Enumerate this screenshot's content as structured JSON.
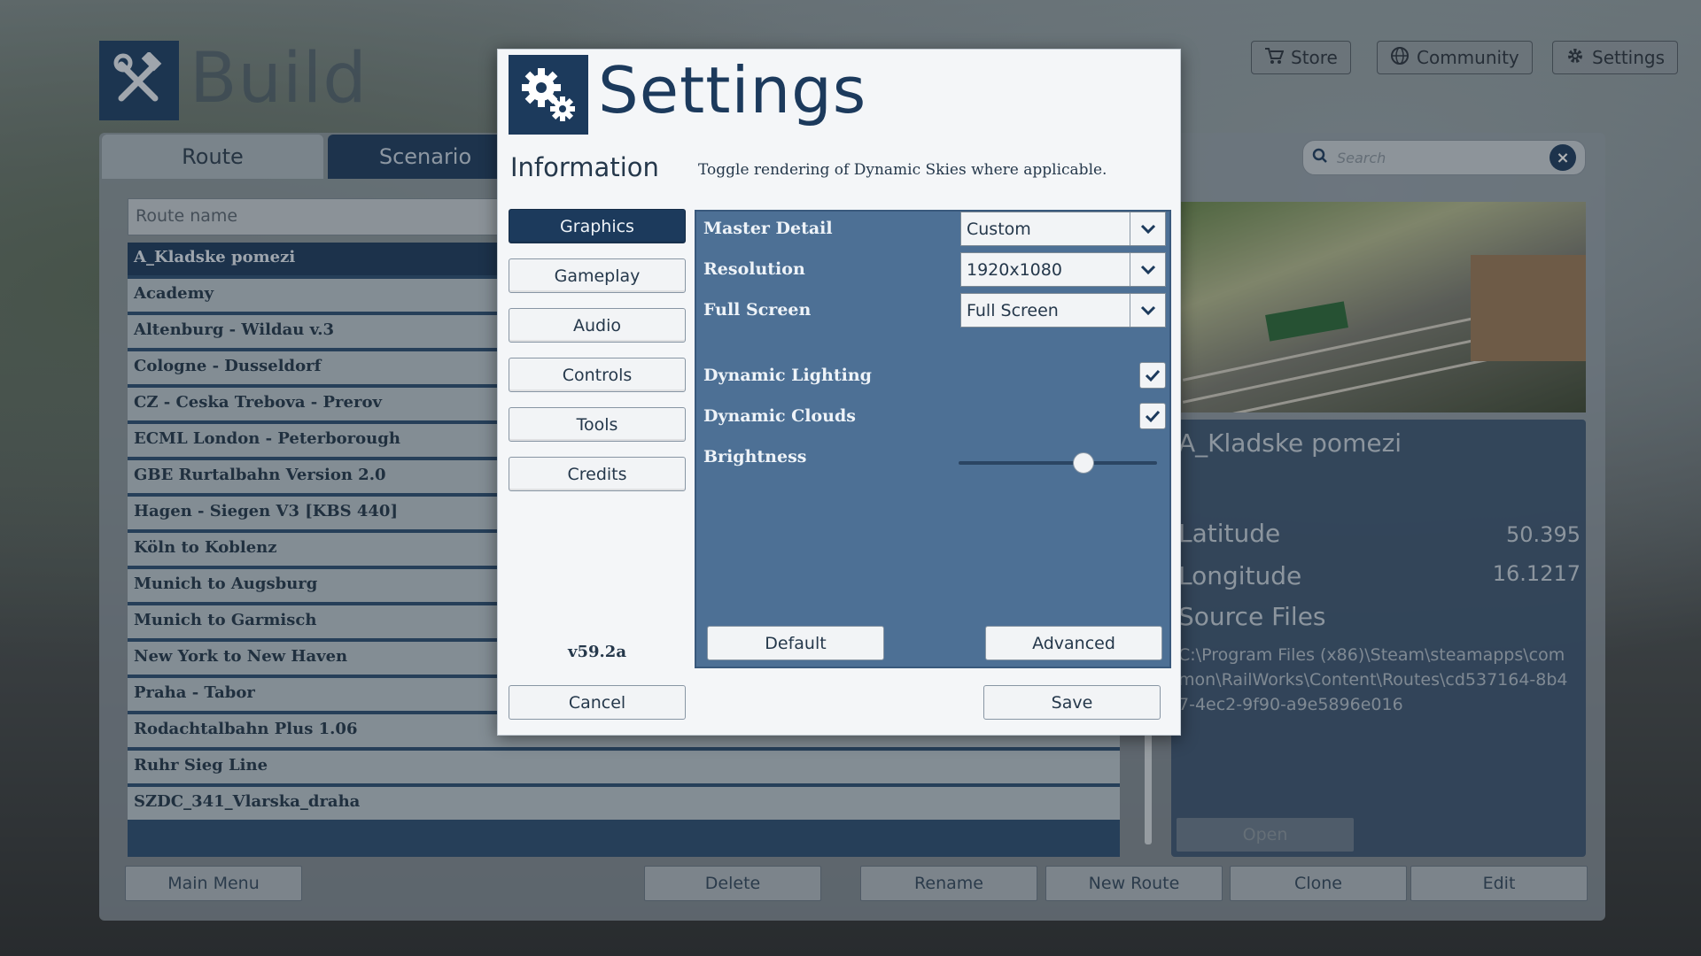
{
  "app": {
    "title": "Build",
    "top_buttons": [
      {
        "label": "Store",
        "icon": "cart-icon"
      },
      {
        "label": "Community",
        "icon": "globe-icon"
      },
      {
        "label": "Settings",
        "icon": "gear-icon"
      }
    ],
    "tabs": [
      {
        "label": "Route",
        "active": true
      },
      {
        "label": "Scenario",
        "active": false
      }
    ],
    "route_name_placeholder": "Route name",
    "search_placeholder": "Search",
    "routes": [
      "A_Kladske pomezi",
      "Academy",
      "Altenburg - Wildau v.3",
      "Cologne - Dusseldorf",
      "CZ - Ceska Trebova - Prerov",
      "ECML London - Peterborough",
      "GBE Rurtalbahn Version 2.0",
      "Hagen - Siegen V3 [KBS 440]",
      "Köln to Koblenz",
      "Munich to Augsburg",
      "Munich to Garmisch",
      "New York to New Haven",
      "Praha - Tabor",
      "Rodachtalbahn Plus 1.06",
      "Ruhr Sieg Line",
      "SZDC_341_Vlarska_draha"
    ],
    "selected_route_index": 0,
    "details": {
      "title": "A_Kladske pomezi",
      "latitude_label": "Latitude",
      "latitude": "50.395",
      "longitude_label": "Longitude",
      "longitude": "16.1217",
      "source_label": "Source Files",
      "source_path": "C:\\Program Files (x86)\\Steam\\steamapps\\common\\RailWorks\\Content\\Routes\\cd537164-8b47-4ec2-9f90-a9e5896e016",
      "open_label": "Open"
    },
    "bottom_buttons": [
      "Main Menu",
      "Delete",
      "Rename",
      "New Route",
      "Clone",
      "Edit"
    ]
  },
  "settings": {
    "title": "Settings",
    "section": "Information",
    "info_text": "Toggle rendering of Dynamic Skies where applicable.",
    "nav": [
      {
        "label": "Graphics",
        "active": true
      },
      {
        "label": "Gameplay",
        "active": false
      },
      {
        "label": "Audio",
        "active": false
      },
      {
        "label": "Controls",
        "active": false
      },
      {
        "label": "Tools",
        "active": false
      },
      {
        "label": "Credits",
        "active": false
      }
    ],
    "version": "v59.2a",
    "master_detail": {
      "label": "Master Detail",
      "value": "Custom"
    },
    "resolution": {
      "label": "Resolution",
      "value": "1920x1080"
    },
    "full_screen": {
      "label": "Full Screen",
      "value": "Full Screen"
    },
    "dynamic_lighting": {
      "label": "Dynamic Lighting",
      "checked": true
    },
    "dynamic_clouds": {
      "label": "Dynamic Clouds",
      "checked": true
    },
    "brightness": {
      "label": "Brightness",
      "value_fraction": 0.63
    },
    "default_label": "Default",
    "advanced_label": "Advanced",
    "cancel_label": "Cancel",
    "save_label": "Save"
  },
  "colors": {
    "accent_dark_blue": "#1c3a5c",
    "content_panel": "#4d7095"
  }
}
